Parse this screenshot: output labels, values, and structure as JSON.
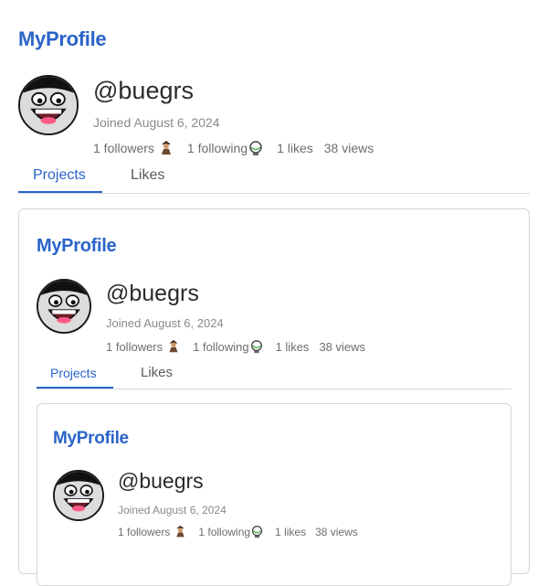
{
  "brand": "MyProfile",
  "profile": {
    "handle": "@buegrs",
    "joined": "Joined August 6, 2024",
    "followers": "1 followers",
    "following": "1 following",
    "likes": "1 likes",
    "views": "38 views"
  },
  "tabs": {
    "projects": "Projects",
    "likes": "Likes"
  },
  "icons": {
    "avatar": "grinning-face-avatar-icon",
    "follower": "follower-avatar-icon",
    "following": "following-avatar-icon"
  },
  "colors": {
    "accent": "#2a64c8",
    "text_muted": "#8a8a8a"
  }
}
